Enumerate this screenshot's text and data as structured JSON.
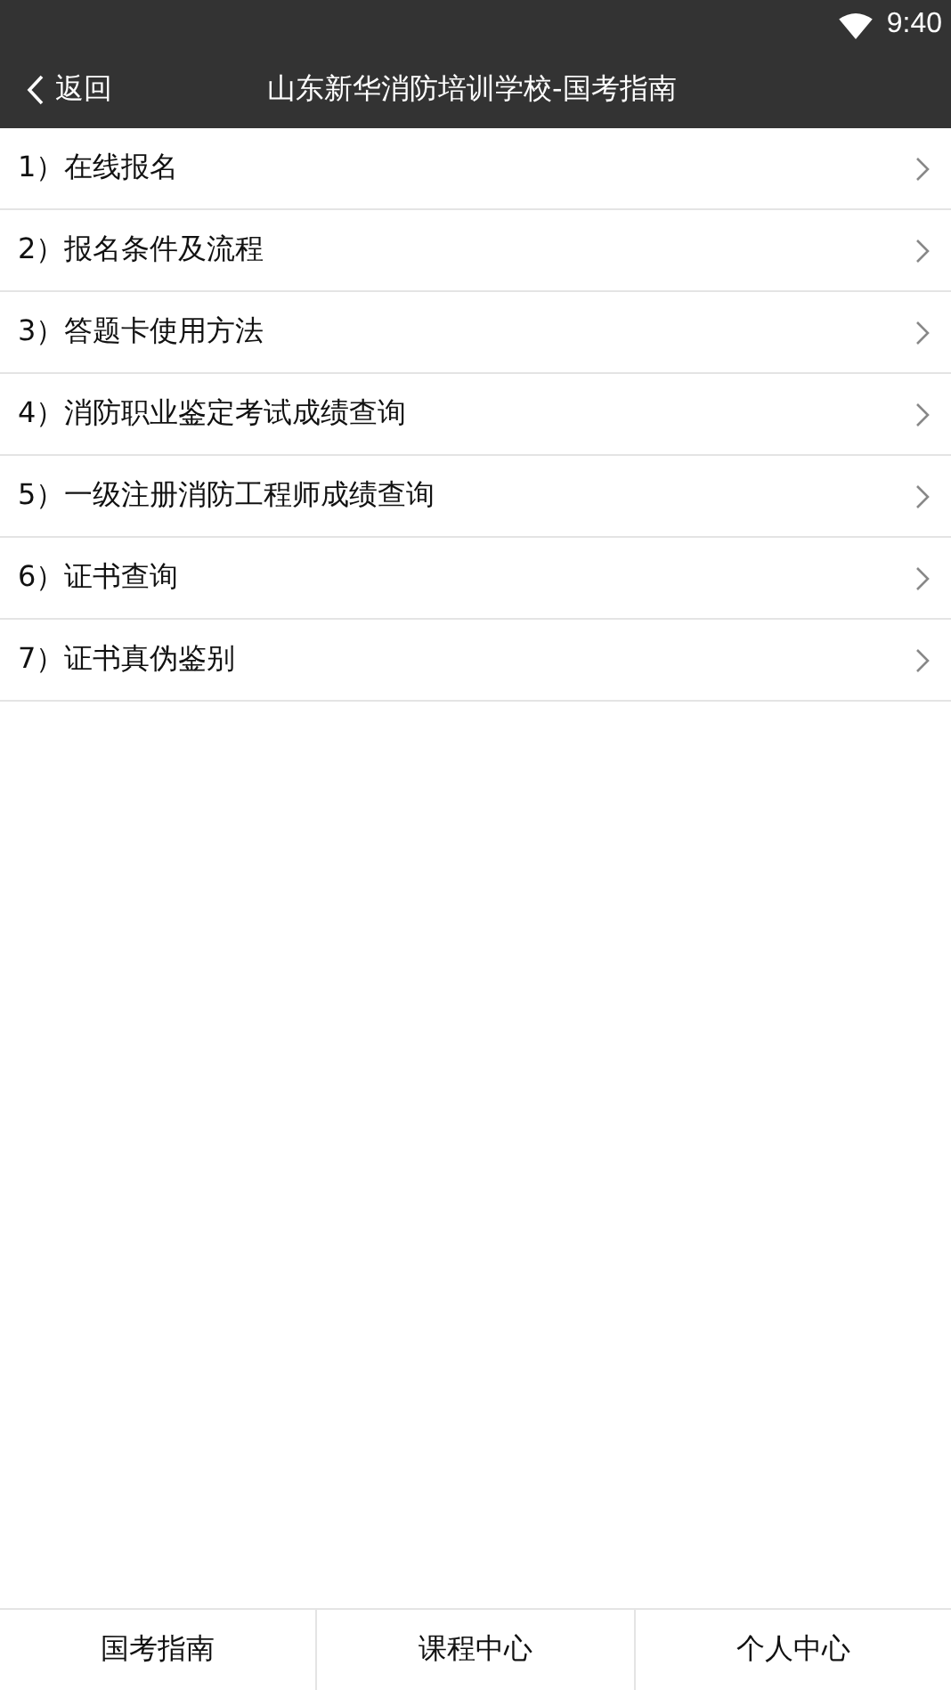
{
  "status_bar": {
    "time": "9:40"
  },
  "header": {
    "back": "返回",
    "title": "山东新华消防培训学校-国考指南"
  },
  "items": [
    {
      "label": "1）在线报名"
    },
    {
      "label": "2）报名条件及流程"
    },
    {
      "label": "3）答题卡使用方法"
    },
    {
      "label": "4）消防职业鉴定考试成绩查询"
    },
    {
      "label": "5）一级注册消防工程师成绩查询"
    },
    {
      "label": "6）证书查询"
    },
    {
      "label": "7）证书真伪鉴别"
    }
  ],
  "tabs": [
    {
      "label": "国考指南"
    },
    {
      "label": "课程中心"
    },
    {
      "label": "个人中心"
    }
  ]
}
